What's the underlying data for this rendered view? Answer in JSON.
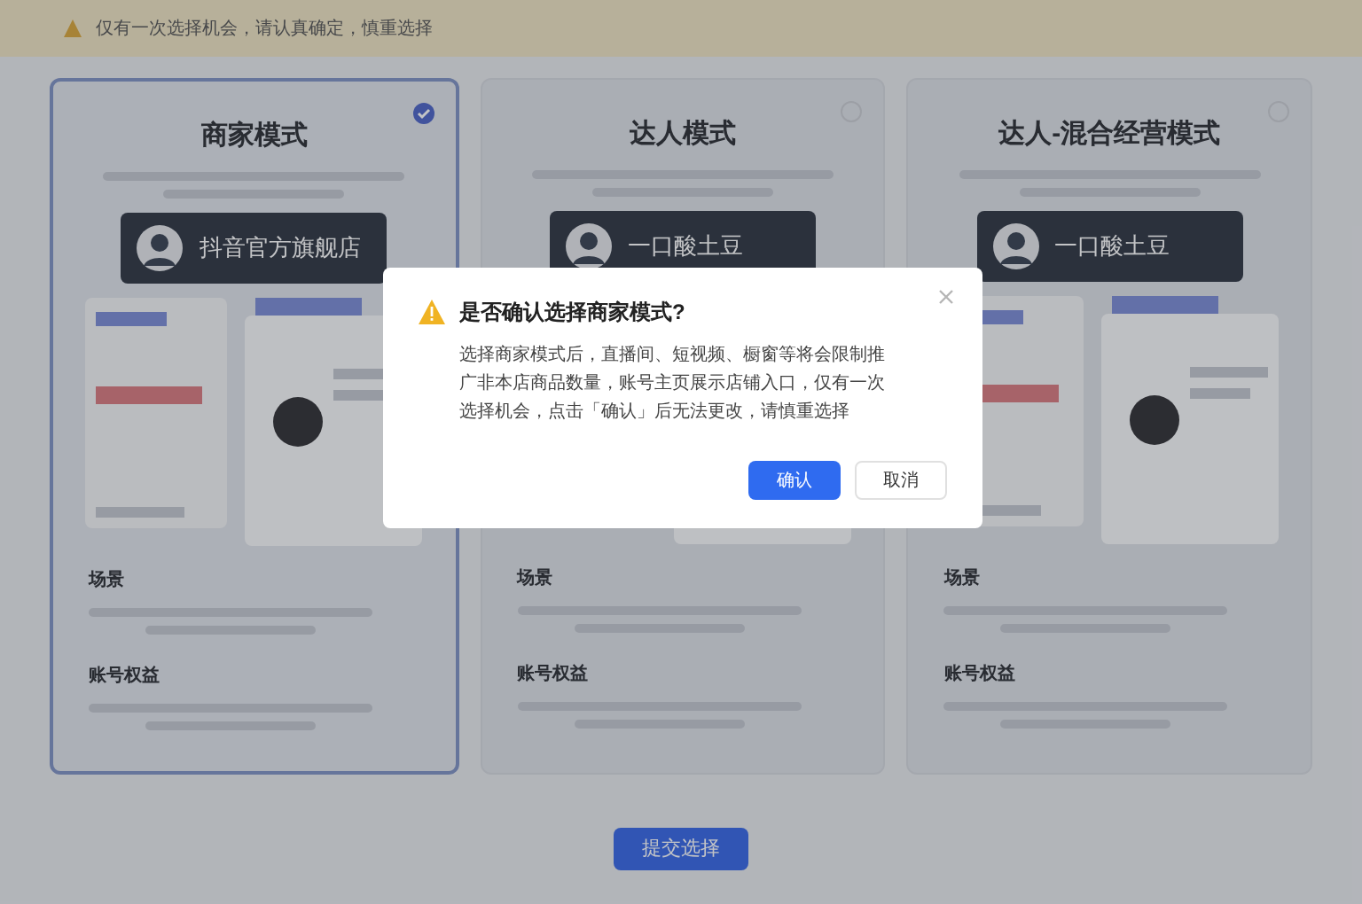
{
  "banner": {
    "text": "仅有一次选择机会，请认真确定，慎重选择"
  },
  "cards": [
    {
      "title": "商家模式",
      "selected": true,
      "store_name": "抖音官方旗舰店",
      "sections": [
        "场景",
        "账号权益"
      ]
    },
    {
      "title": "达人模式",
      "selected": false,
      "store_name": "一口酸土豆",
      "sections": [
        "场景",
        "账号权益"
      ]
    },
    {
      "title": "达人-混合经营模式",
      "selected": false,
      "store_name": "一口酸土豆",
      "sections": [
        "场景",
        "账号权益"
      ]
    }
  ],
  "submit_button": "提交选择",
  "dialog": {
    "title": "是否确认选择商家模式?",
    "message": "选择商家模式后，直播间、短视频、橱窗等将会限制推广非本店商品数量，账号主页展示店铺入口，仅有一次选择机会，点击「确认」后无法更改，请慎重选择",
    "confirm": "确认",
    "cancel": "取消"
  }
}
